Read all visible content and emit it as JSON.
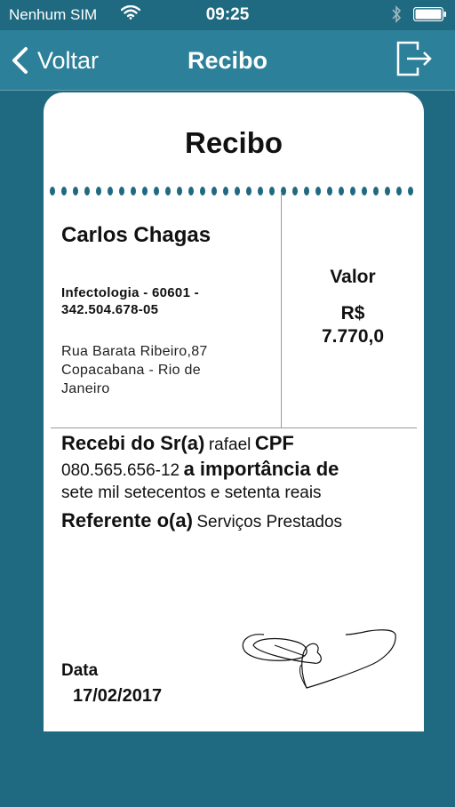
{
  "status_bar": {
    "carrier": "Nenhum SIM",
    "time": "09:25"
  },
  "nav": {
    "back_label": "Voltar",
    "title": "Recibo",
    "exit_icon": "logout-icon"
  },
  "receipt": {
    "title": "Recibo",
    "provider_name": "Carlos Chagas",
    "specialty_line1": "Infectologia - 60601 -",
    "specialty_line2": "342.504.678-05",
    "address_line1": "Rua Barata Ribeiro,87",
    "address_line2": "Copacabana - Rio de",
    "address_line3": "Janeiro",
    "value_label": "Valor",
    "currency": "R$",
    "amount": "7.770,0",
    "received_from_label": "Recebi do Sr(a)",
    "payer_name": "rafael",
    "cpf_label": "CPF",
    "payer_cpf": "080.565.656-12",
    "importance_label": "a importância de",
    "amount_in_words": "sete mil setecentos e setenta reais",
    "referring_label": "Referente o(a)",
    "service": "Serviços Prestados",
    "date_label": "Data",
    "date": "17/02/2017"
  },
  "colors": {
    "background": "#1f6a80",
    "nav_bar": "#2d8099",
    "dots": "#1f6a80"
  }
}
